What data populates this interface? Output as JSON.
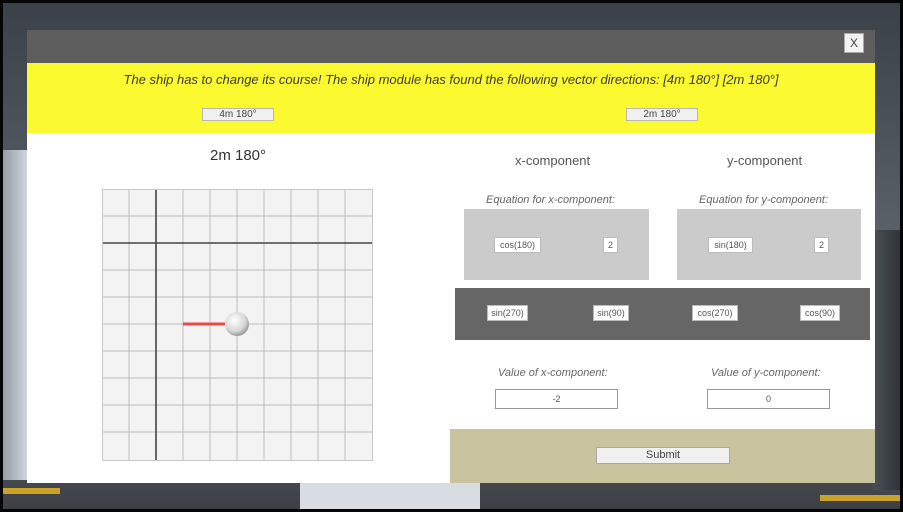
{
  "dialog": {
    "close_label": "X",
    "banner_text": "The ship has to change its course! The ship module has found the following vector directions: [4m 180°] [2m 180°]",
    "vector_buttons": [
      "4m 180°",
      "2m 180°"
    ],
    "grid_title": "2m 180°",
    "columns": {
      "x": "x-component",
      "y": "y-component"
    },
    "equation_labels": {
      "x": "Equation for x-component:",
      "y": "Equation for y-component:"
    },
    "x_equation": {
      "func": "cos(180)",
      "magnitude": "2"
    },
    "y_equation": {
      "func": "sin(180)",
      "magnitude": "2"
    },
    "bank_chips": [
      "sin(270)",
      "sin(90)",
      "cos(270)",
      "cos(90)"
    ],
    "value_labels": {
      "x": "Value of x-component:",
      "y": "Value of y-component:"
    },
    "values": {
      "x": "-2",
      "y": "0"
    },
    "submit_label": "Submit"
  },
  "colors": {
    "banner": "#fbf930",
    "titlebar": "#5d5d5d",
    "vector_arrow": "#e84a4a",
    "footer": "#c9c49e"
  }
}
